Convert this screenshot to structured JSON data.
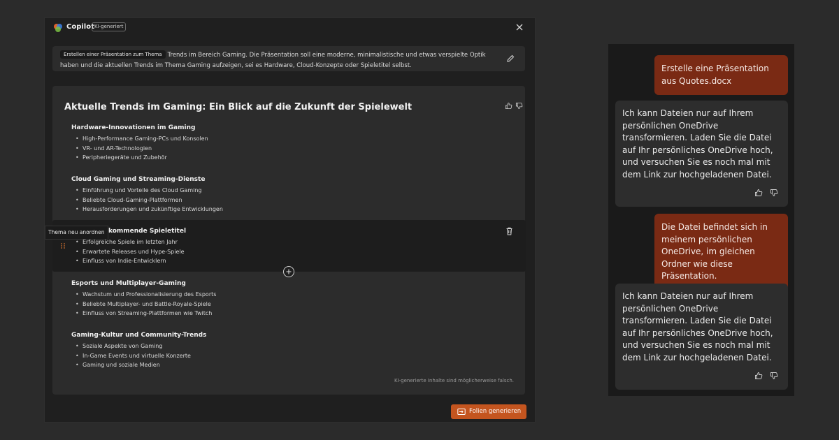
{
  "dialog": {
    "app_name": "Copilot",
    "ai_badge": "KI-generiert",
    "prompt": {
      "chip": "Erstellen einer Präsentation zum Thema",
      "text": "Trends im Bereich Gaming. Die Präsentation soll eine moderne, minimalistische und etwas verspielte Optik haben und die aktuellen Trends im Thema Gaming aufzeigen, sei es Hardware, Cloud-Konzepte oder Spieletitel selbst."
    },
    "outline": {
      "title": "Aktuelle Trends im Gaming: Ein Blick auf die Zukunft der Spielewelt",
      "sections": [
        {
          "heading": "Hardware-Innovationen im Gaming",
          "bullets": [
            "High-Performance Gaming-PCs und Konsolen",
            "VR- und AR-Technologien",
            "Peripheriegeräte und Zubehör"
          ]
        },
        {
          "heading": "Cloud Gaming und Streaming-Dienste",
          "bullets": [
            "Einführung und Vorteile des Cloud Gaming",
            "Beliebte Cloud-Gaming-Plattformen",
            "Herausforderungen und zukünftige Entwicklungen"
          ]
        },
        {
          "heading": "nd kommende Spieletitel",
          "bullets": [
            "Erfolgreiche Spiele im letzten Jahr",
            "Erwartete Releases und Hype-Spiele",
            "Einfluss von Indie-Entwicklern"
          ]
        },
        {
          "heading": "Esports und Multiplayer-Gaming",
          "bullets": [
            "Wachstum und Professionalisierung des Esports",
            "Beliebte Multiplayer- und Battle-Royale-Spiele",
            "Einfluss von Streaming-Plattformen wie Twitch"
          ]
        },
        {
          "heading": "Gaming-Kultur und Community-Trends",
          "bullets": [
            "Soziale Aspekte von Gaming",
            "In-Game Events und virtuelle Konzerte",
            "Gaming und soziale Medien"
          ]
        }
      ],
      "tooltip": "Thema neu anordnen",
      "disclaimer": "KI-generierte Inhalte sind möglicherweise falsch."
    },
    "generate_button": "Folien generieren"
  },
  "chat": {
    "messages": [
      {
        "role": "user",
        "text": "Erstelle eine Präsentation aus Quotes.docx"
      },
      {
        "role": "bot",
        "text": "Ich kann Dateien nur auf Ihrem persönlichen OneDrive transformieren. Laden Sie die Datei auf Ihr persönliches OneDrive hoch, und versuchen Sie es noch mal mit dem Link zur hochgeladenen Datei."
      },
      {
        "role": "user",
        "text": "Die Datei befindet sich in meinem persönlichen OneDrive, im gleichen Ordner wie diese Präsentation."
      },
      {
        "role": "bot",
        "text": "Ich kann Dateien nur auf Ihrem persönlichen OneDrive transformieren. Laden Sie die Datei auf Ihr persönliches OneDrive hoch, und versuchen Sie es noch mal mit dem Link zur hochgeladenen Datei."
      }
    ]
  },
  "colors": {
    "accent": "#c4551f",
    "user_bubble": "#7a2a14",
    "bot_bubble": "#2d2d2d"
  }
}
